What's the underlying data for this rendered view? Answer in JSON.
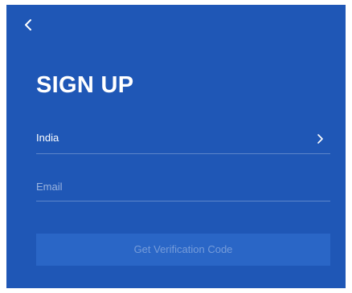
{
  "theme": {
    "background": "#1f57b6",
    "button_background": "#2a66c6",
    "text": "#ffffff"
  },
  "header": {
    "back_icon": "chevron-left-icon"
  },
  "page": {
    "title": "SIGN UP"
  },
  "form": {
    "country": {
      "value": "India",
      "icon": "chevron-right-icon"
    },
    "email": {
      "value": "",
      "placeholder": "Email"
    },
    "submit": {
      "label": "Get Verification Code",
      "state": "disabled"
    }
  }
}
